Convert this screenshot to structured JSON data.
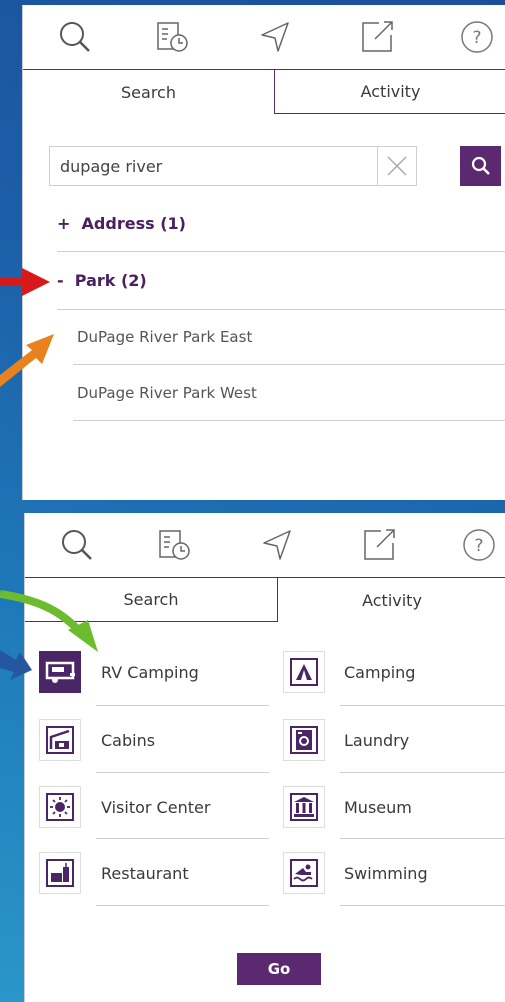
{
  "toolbar": {
    "icons": [
      "search-icon",
      "history-icon",
      "navigate-icon",
      "share-icon",
      "help-icon"
    ],
    "help_glyph": "?"
  },
  "tabs": {
    "search": "Search",
    "activity": "Activity"
  },
  "search": {
    "value": "dupage river",
    "placeholder": ""
  },
  "results": {
    "groups": [
      {
        "prefix": "+",
        "label": "Address (1)"
      },
      {
        "prefix": "-",
        "label": "Park (2)"
      }
    ],
    "items": [
      "DuPage River Park East",
      "DuPage River Park West"
    ]
  },
  "activities": [
    {
      "label": "RV Camping",
      "icon": "rv-camping-icon",
      "selected": true
    },
    {
      "label": "Camping",
      "icon": "tent-icon",
      "selected": false
    },
    {
      "label": "Cabins",
      "icon": "cabin-icon",
      "selected": false
    },
    {
      "label": "Laundry",
      "icon": "laundry-icon",
      "selected": false
    },
    {
      "label": "Visitor Center",
      "icon": "visitor-center-icon",
      "selected": false
    },
    {
      "label": "Museum",
      "icon": "museum-icon",
      "selected": false
    },
    {
      "label": "Restaurant",
      "icon": "restaurant-icon",
      "selected": false
    },
    {
      "label": "Swimming",
      "icon": "swimming-icon",
      "selected": false
    }
  ],
  "go_label": "Go",
  "colors": {
    "accent": "#5b2970",
    "heading": "#4a2060",
    "arrow_red": "#d7191c",
    "arrow_orange": "#e8821e",
    "arrow_green": "#6dbb2f",
    "arrow_blue": "#2556a0"
  }
}
